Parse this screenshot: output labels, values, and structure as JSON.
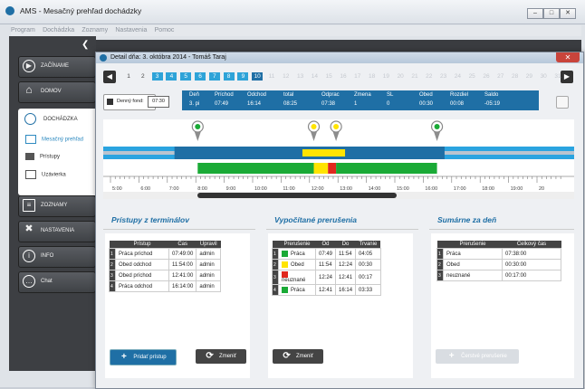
{
  "app": {
    "title": "AMS - Mesačný prehľad dochádzky"
  },
  "menu": [
    "Program",
    "Dochádzka",
    "Zoznamy",
    "Nastavenia",
    "Pomoc"
  ],
  "sidebar": {
    "items": [
      {
        "label": "ZAČÍNAME",
        "icon": "play-icon"
      },
      {
        "label": "DOMOV",
        "icon": "home-icon"
      },
      {
        "label": "DOCHÁDZKA",
        "icon": "clock-icon"
      },
      {
        "label": "ZOZNAMY",
        "icon": "list-icon"
      },
      {
        "label": "NASTAVENIA",
        "icon": "tools-icon"
      },
      {
        "label": "INFO",
        "icon": "info-icon"
      },
      {
        "label": "Chat",
        "icon": "chat-icon"
      }
    ],
    "subitems": [
      {
        "label": "Mesačný prehľad",
        "icon": "book-icon"
      },
      {
        "label": "Prístupy",
        "icon": "door-icon"
      },
      {
        "label": "Uzávierka",
        "icon": "lock-icon"
      }
    ]
  },
  "dialog": {
    "title": "Detail dňa: 3. októbra 2014 - Tomáš Taraj",
    "days": [
      "1",
      "2",
      "3",
      "4",
      "5",
      "6",
      "7",
      "8",
      "9",
      "10",
      "11",
      "12",
      "13",
      "14",
      "15",
      "16",
      "17",
      "18",
      "19",
      "20",
      "21",
      "22",
      "23",
      "24",
      "25",
      "26",
      "27",
      "28",
      "29",
      "30",
      "31"
    ],
    "fund_label": "Denný fond:",
    "fund_value": "07:30",
    "summary": {
      "headers": [
        "Deň",
        "Príchod",
        "Odchod",
        "total",
        "Odprac",
        "Zmena",
        "SL",
        "Obed",
        "Rozdiel",
        "Saldo"
      ],
      "values": [
        "3. pi",
        "07:49",
        "16:14",
        "08:25",
        "07:38",
        "1",
        "0",
        "00:30",
        "00:08",
        "-05:19"
      ]
    },
    "timeline_ticks": [
      "5:00",
      "6:00",
      "7:00",
      "8:00",
      "9:00",
      "10:00",
      "11:00",
      "12:00",
      "13:00",
      "14:00",
      "15:00",
      "16:00",
      "17:00",
      "18:00",
      "19:00",
      "20"
    ],
    "panel_access": {
      "title": "Prístupy z terminálov",
      "headers": [
        "Prístup",
        "Čas",
        "Upravil"
      ],
      "rows": [
        [
          "Práca príchod",
          "07:49:00",
          "admin"
        ],
        [
          "Obed odchod",
          "11:54:00",
          "admin"
        ],
        [
          "Obed príchod",
          "12:41:00",
          "admin"
        ],
        [
          "Práca odchod",
          "16:14:00",
          "admin"
        ]
      ],
      "add_button": "Pridať prístup",
      "change_button": "Zmeniť"
    },
    "panel_breaks": {
      "title": "Vypočítané prerušenia",
      "headers": [
        "Prerušenie",
        "Od",
        "Do",
        "Trvanie"
      ],
      "rows": [
        {
          "name": "Práca",
          "from": "07:49",
          "to": "11:54",
          "dur": "04:05",
          "color": "#1aaa36"
        },
        {
          "name": "Obed",
          "from": "11:54",
          "to": "12:24",
          "dur": "00:30",
          "color": "#ffe400"
        },
        {
          "name": "neuznané",
          "from": "12:24",
          "to": "12:41",
          "dur": "00:17",
          "color": "#e0281e"
        },
        {
          "name": "Práca",
          "from": "12:41",
          "to": "16:14",
          "dur": "03:33",
          "color": "#1aaa36"
        }
      ],
      "change_button": "Zmeniť"
    },
    "panel_sum": {
      "title": "Sumárne za deň",
      "headers": [
        "Prerušenie",
        "Celkový čas"
      ],
      "rows": [
        [
          "Práca",
          "07:38:00"
        ],
        [
          "Obed",
          "00:30:00"
        ],
        [
          "neuznané",
          "00:17:00"
        ]
      ],
      "add_button": "Čerstvé prerušenie"
    }
  }
}
